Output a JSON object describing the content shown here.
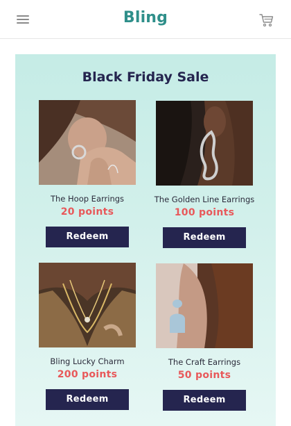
{
  "header": {
    "logo_text": "Bling",
    "menu_icon": "hamburger-menu-icon",
    "cart_icon": "shopping-cart-icon",
    "accent_color": "#2f8f8a"
  },
  "promo": {
    "title": "Black Friday Sale",
    "background_color": "#c5ece6",
    "button_color": "#25254f",
    "points_color": "#e8585a",
    "products": [
      {
        "name": "The Hoop Earrings",
        "points": "20 points",
        "button_label": "Redeem",
        "image": "woman wearing hoop earring photo"
      },
      {
        "name": "The Golden Line Earrings",
        "points": "100 points",
        "button_label": "Redeem",
        "image": "woman wearing wavy silver earring photo"
      },
      {
        "name": "Bling Lucky Charm",
        "points": "200 points",
        "button_label": "Redeem",
        "image": "layered gold necklaces photo"
      },
      {
        "name": "The Craft Earrings",
        "points": "50 points",
        "button_label": "Redeem",
        "image": "blue arch drop earring photo"
      }
    ]
  }
}
